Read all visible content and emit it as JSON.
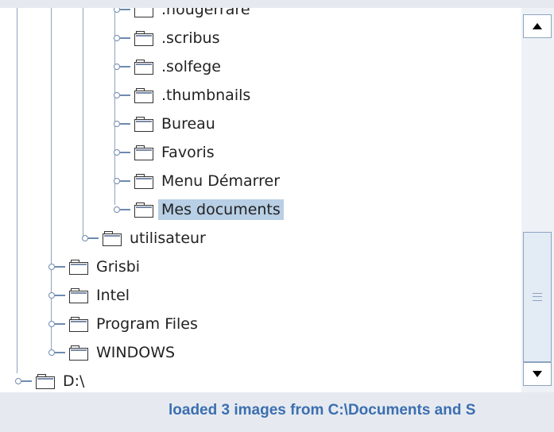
{
  "tree": {
    "items": [
      {
        "label": ".nougerrare",
        "level": 3
      },
      {
        "label": ".scribus",
        "level": 3
      },
      {
        "label": ".solfege",
        "level": 3
      },
      {
        "label": ".thumbnails",
        "level": 3
      },
      {
        "label": "Bureau",
        "level": 3
      },
      {
        "label": "Favoris",
        "level": 3
      },
      {
        "label": "Menu Démarrer",
        "level": 3
      },
      {
        "label": "Mes documents",
        "level": 3,
        "selected": true
      },
      {
        "label": "utilisateur",
        "level": 2
      },
      {
        "label": "Grisbi",
        "level": 1
      },
      {
        "label": "Intel",
        "level": 1
      },
      {
        "label": "Program Files",
        "level": 1
      },
      {
        "label": "WINDOWS",
        "level": 1
      },
      {
        "label": "D:\\",
        "level": 0
      }
    ]
  },
  "status_bar": {
    "text": "loaded 3 images from C:\\Documents and S"
  },
  "icons": {
    "expand_handle": "collapsed-node-handle-icon",
    "folder": "folder-icon",
    "scroll_up": "arrow-up-icon",
    "scroll_down": "arrow-down-icon",
    "thumb_grip": "grip-icon"
  },
  "colors": {
    "selection": "#b8cfe5",
    "status_text": "#3b6fb0",
    "tree_lines": "#8ea4c0"
  }
}
